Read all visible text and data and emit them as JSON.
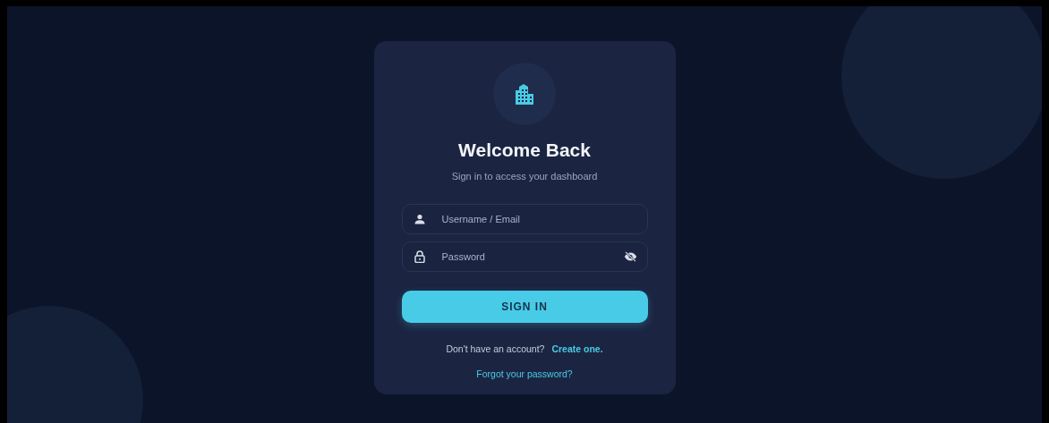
{
  "title": "Welcome Back",
  "subtitle": "Sign in to access your dashboard",
  "fields": [
    {
      "kind": "user",
      "placeholder": "Username / Email"
    },
    {
      "kind": "password",
      "placeholder": "Password"
    }
  ],
  "submit": "SIGN IN",
  "signup": {
    "prompt": "Don't have an account?",
    "link": "Create one."
  },
  "forgot": "Forgot your password?"
}
